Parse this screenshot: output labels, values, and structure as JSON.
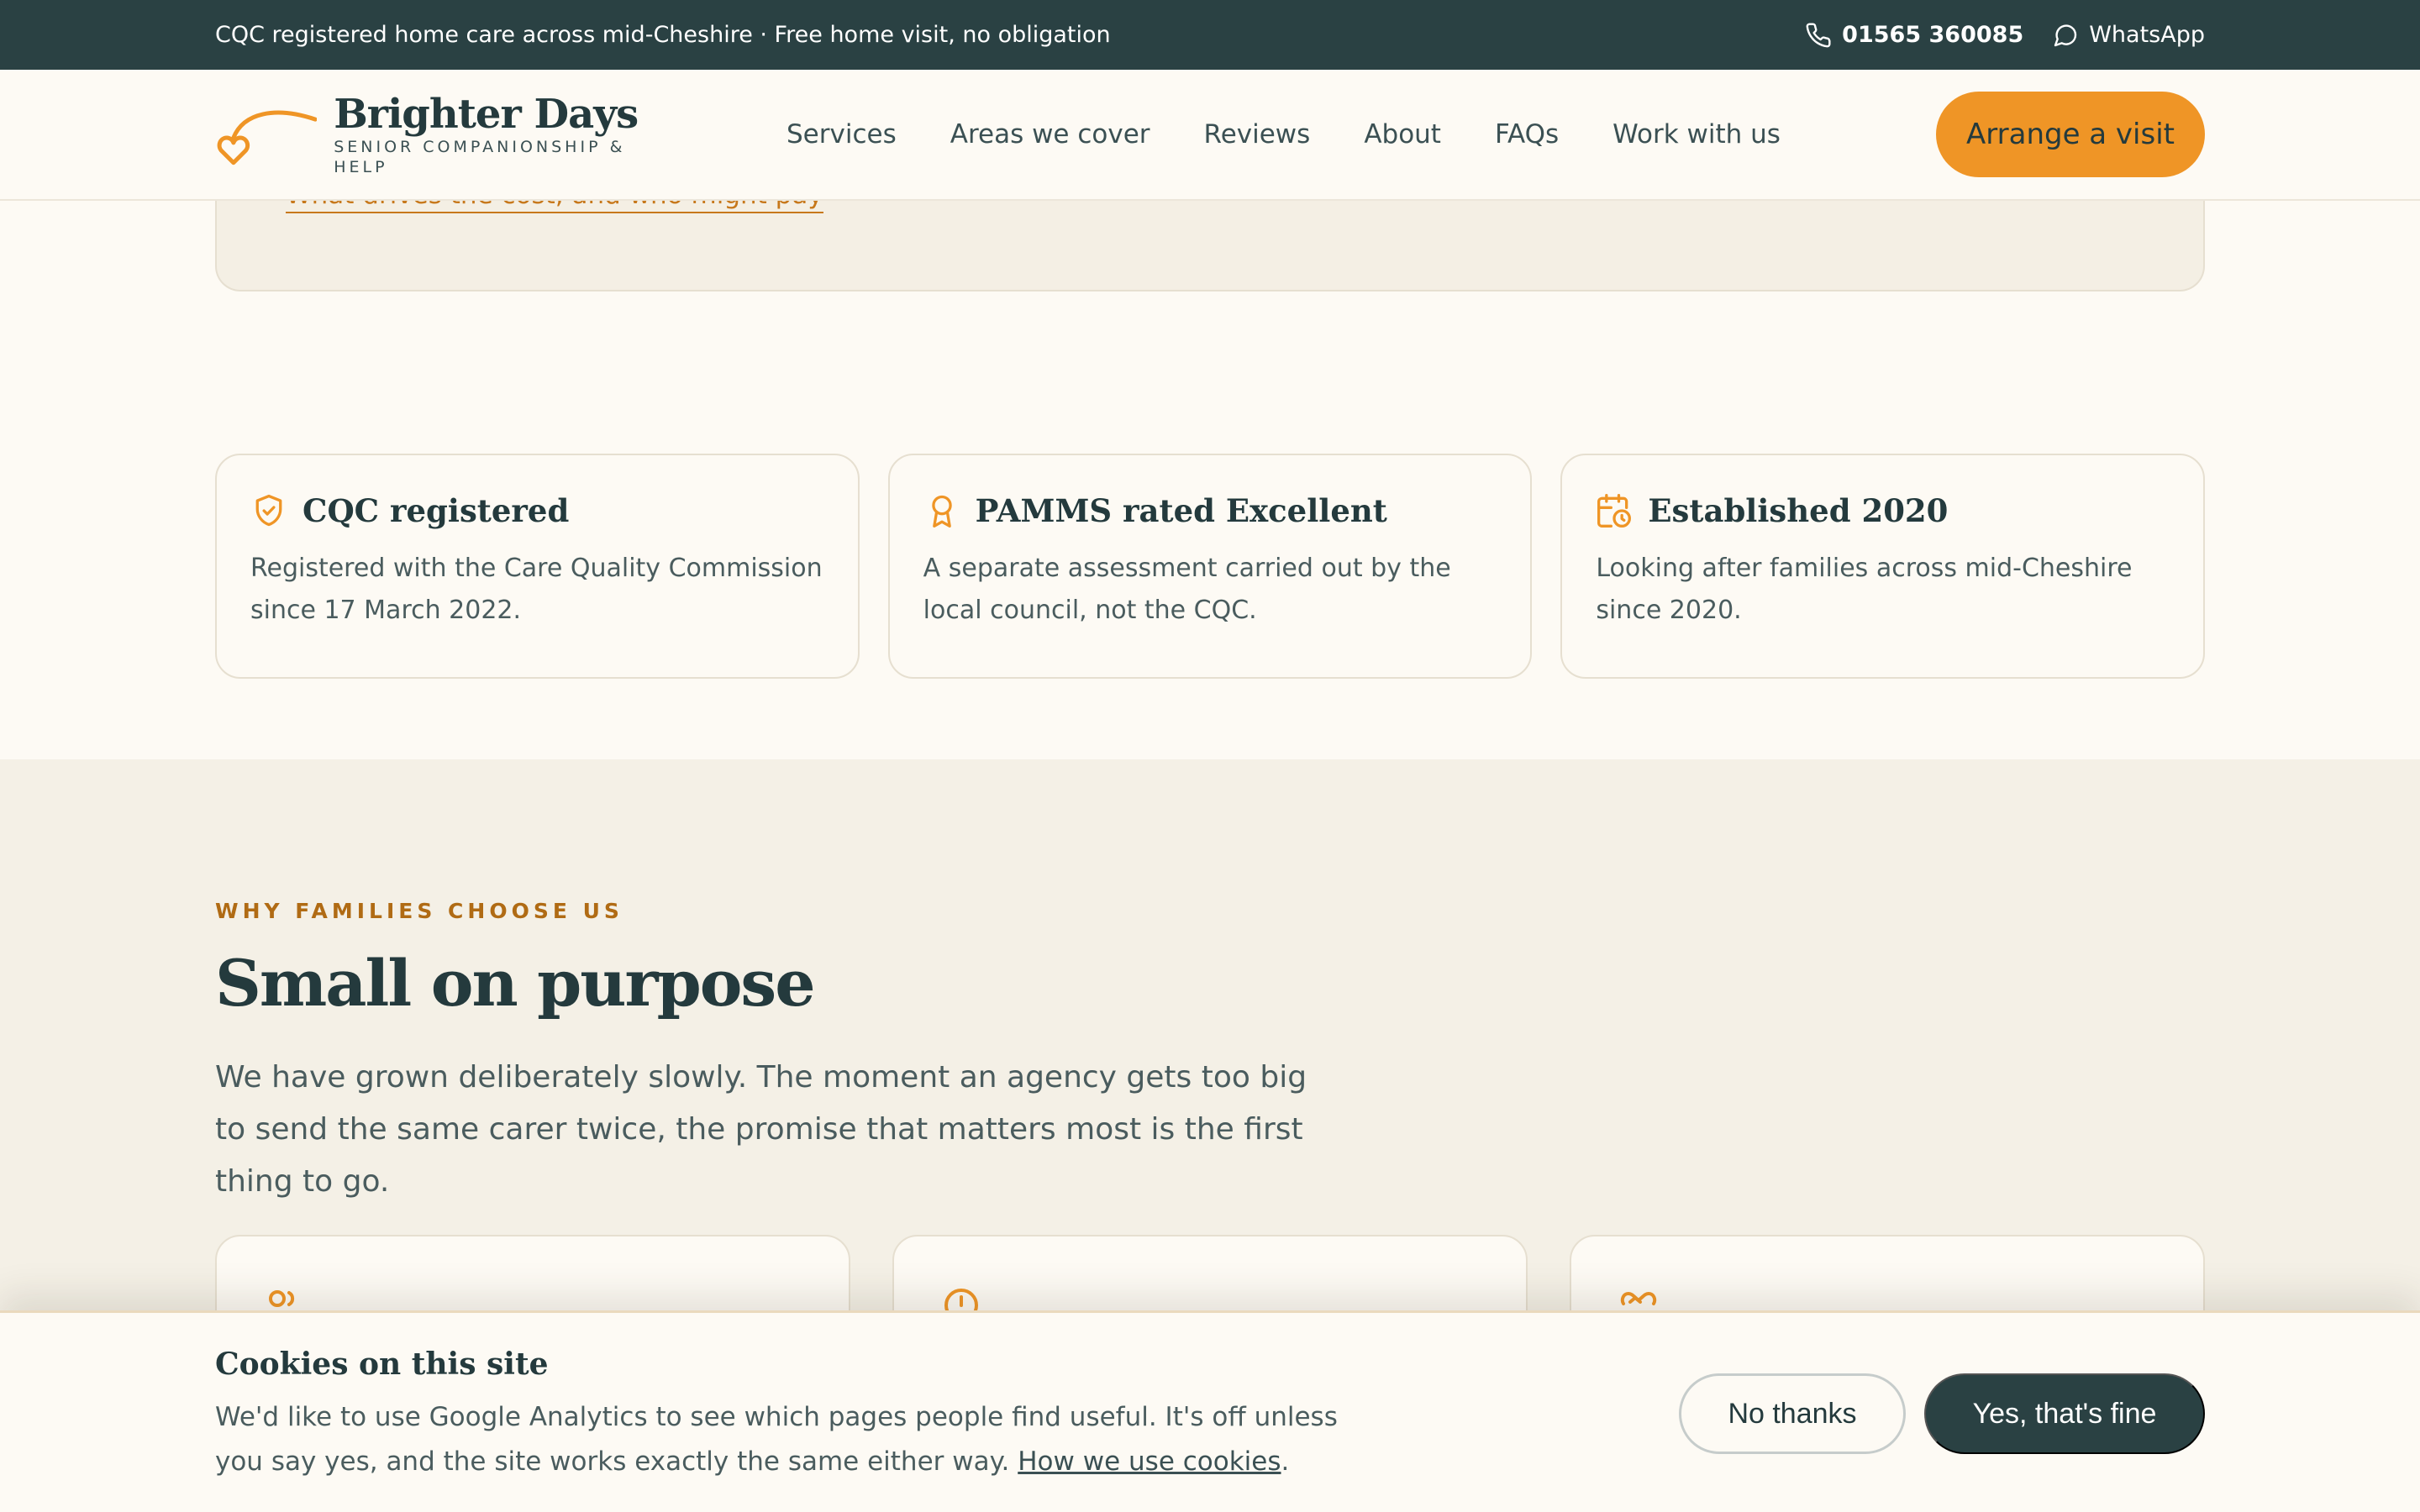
{
  "topbar": {
    "tagline": "CQC registered home care across mid-Cheshire · Free home visit, no obligation",
    "phone": "01565 360085",
    "whatsapp": "WhatsApp"
  },
  "header": {
    "brand_name": "Brighter Days",
    "brand_tagline": "SENIOR COMPANIONSHIP & HELP",
    "nav": [
      "Services",
      "Areas we cover",
      "Reviews",
      "About",
      "FAQs",
      "Work with us"
    ],
    "cta": "Arrange a visit"
  },
  "previous_card": {
    "link_text": "What drives the cost, and who might pay"
  },
  "trust_cards": [
    {
      "icon": "shield-check-icon",
      "title": "CQC registered",
      "body": "Registered with the Care Quality Commission since 17 March 2022."
    },
    {
      "icon": "award-ribbon-icon",
      "title": "PAMMS rated Excellent",
      "body": "A separate assessment carried out by the local council, not the CQC."
    },
    {
      "icon": "calendar-clock-icon",
      "title": "Established 2020",
      "body": "Looking after families across mid-Cheshire since 2020."
    }
  ],
  "why": {
    "eyebrow": "WHY FAMILIES CHOOSE US",
    "title": "Small on purpose",
    "lead": "We have grown deliberately slowly. The moment an agency gets too big to send the same carer twice, the promise that matters most is the first thing to go.",
    "feature_icons": [
      "people-icon",
      "clock-icon",
      "handshake-icon"
    ]
  },
  "cookie": {
    "title": "Cookies on this site",
    "text": "We'd like to use Google Analytics to see which pages people find useful. It's off unless you say yes, and the site works exactly the same either way.",
    "link": "How we use cookies",
    "after_link": ".",
    "decline": "No thanks",
    "accept": "Yes, that's fine"
  },
  "colors": {
    "dark_teal": "#2a4143",
    "accent_orange": "#ef9526",
    "cream": "#fdfaf4",
    "beige": "#f4f0e6"
  }
}
